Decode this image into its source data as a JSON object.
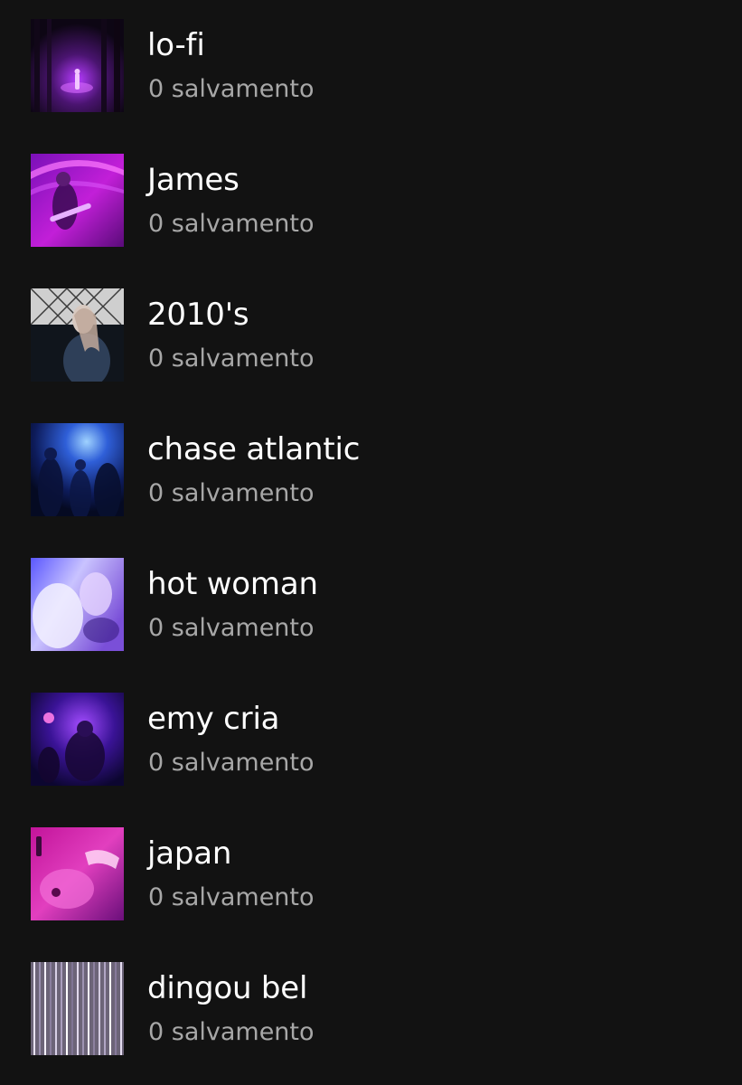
{
  "playlists": [
    {
      "title": "lo-fi",
      "subtitle": "0 salvamento",
      "cover": "forest-neon-figure-cover"
    },
    {
      "title": "James",
      "subtitle": "0 salvamento",
      "cover": "singer-guitar-pink-cover"
    },
    {
      "title": "2010's",
      "subtitle": "0 salvamento",
      "cover": "girl-fence-night-cover"
    },
    {
      "title": "chase atlantic",
      "subtitle": "0 salvamento",
      "cover": "blue-concert-crowd-cover"
    },
    {
      "title": "hot woman",
      "subtitle": "0 salvamento",
      "cover": "blurry-blonde-purple-cover"
    },
    {
      "title": "emy cria",
      "subtitle": "0 salvamento",
      "cover": "purple-party-cover"
    },
    {
      "title": "japan",
      "subtitle": "0 salvamento",
      "cover": "pink-sink-hand-cover"
    },
    {
      "title": "dingou bel",
      "subtitle": "0 salvamento",
      "cover": "silver-tinsel-cover"
    }
  ],
  "colors": {
    "background": "#121212",
    "title": "#ffffff",
    "subtitle": "#a7a7a7"
  }
}
